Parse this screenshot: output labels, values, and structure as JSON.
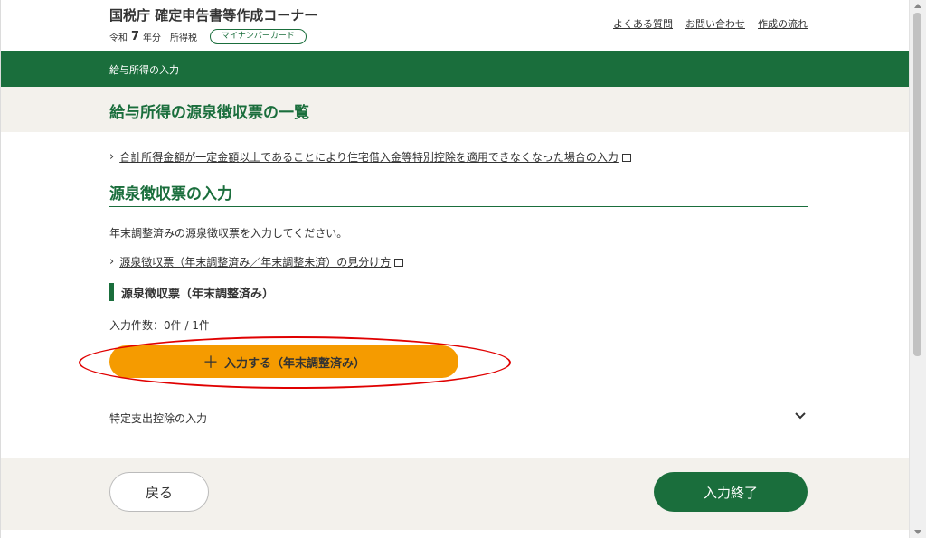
{
  "header": {
    "app_title": "国税庁 確定申告書等作成コーナー",
    "year_prefix": "令和",
    "year_number": "7",
    "year_suffix": "年分",
    "tax_type": "所得税",
    "mynumber_badge": "マイナンバーカード",
    "links": {
      "faq": "よくある質問",
      "contact": "お問い合わせ",
      "flow": "作成の流れ"
    }
  },
  "breadcrumb": "給与所得の入力",
  "page_title": "給与所得の源泉徴収票の一覧",
  "special_link": "合計所得金額が一定金額以上であることにより住宅借入金等特別控除を適用できなくなった場合の入力",
  "section": {
    "title": "源泉徴収票の入力",
    "instruction": "年末調整済みの源泉徴収票を入力してください。",
    "howto_link": "源泉徴収票（年末調整済み／年末調整未済）の見分け方",
    "subheading": "源泉徴収票（年末調整済み）",
    "count_text": "入力件数：0件 / 1件",
    "add_button_plus": "＋",
    "add_button_label": "入力する（年末調整済み）"
  },
  "accordion": {
    "label": "特定支出控除の入力"
  },
  "footer": {
    "back_label": "戻る",
    "finish_label": "入力終了"
  },
  "colors": {
    "brand_green": "#1a6e3c",
    "accent_orange": "#f59b00",
    "band_beige": "#f3f1ec",
    "highlight_red": "#e00000"
  }
}
